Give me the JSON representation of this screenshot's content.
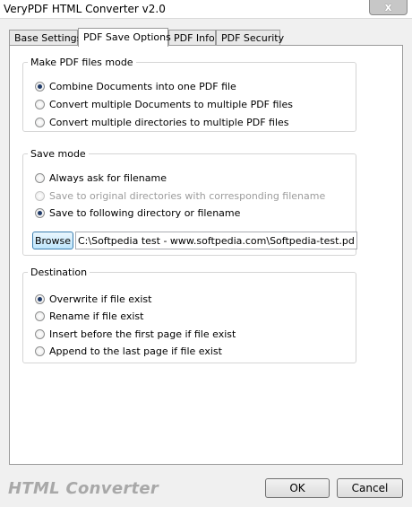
{
  "window": {
    "title": "VeryPDF HTML Converter v2.0",
    "close_glyph": "x"
  },
  "tabs": [
    {
      "label": "Base Settings",
      "active": false
    },
    {
      "label": "PDF Save Options",
      "active": true
    },
    {
      "label": "PDF Info",
      "active": false
    },
    {
      "label": "PDF Security",
      "active": false
    }
  ],
  "make_mode": {
    "legend": "Make PDF files mode",
    "options": [
      {
        "label": "Combine Documents into one PDF file",
        "checked": true
      },
      {
        "label": "Convert multiple Documents to multiple PDF files",
        "checked": false
      },
      {
        "label": "Convert multiple directories to multiple PDF files",
        "checked": false
      }
    ]
  },
  "save_mode": {
    "legend": "Save mode",
    "options": [
      {
        "label": "Always ask for filename",
        "checked": false,
        "disabled": false
      },
      {
        "label": "Save to original directories with corresponding filename",
        "checked": false,
        "disabled": true
      },
      {
        "label": "Save to following directory or filename",
        "checked": true,
        "disabled": false
      }
    ],
    "browse_label": "Browse",
    "path_value": "C:\\Softpedia test - www.softpedia.com\\Softpedia-test.pdf"
  },
  "destination": {
    "legend": "Destination",
    "options": [
      {
        "label": "Overwrite if file exist",
        "checked": true
      },
      {
        "label": "Rename if file exist",
        "checked": false
      },
      {
        "label": "Insert before the first page if file exist",
        "checked": false
      },
      {
        "label": "Append to the last page if file exist",
        "checked": false
      }
    ]
  },
  "footer": {
    "logo_text": "HTML Converter",
    "ok_label": "OK",
    "cancel_label": "Cancel"
  }
}
